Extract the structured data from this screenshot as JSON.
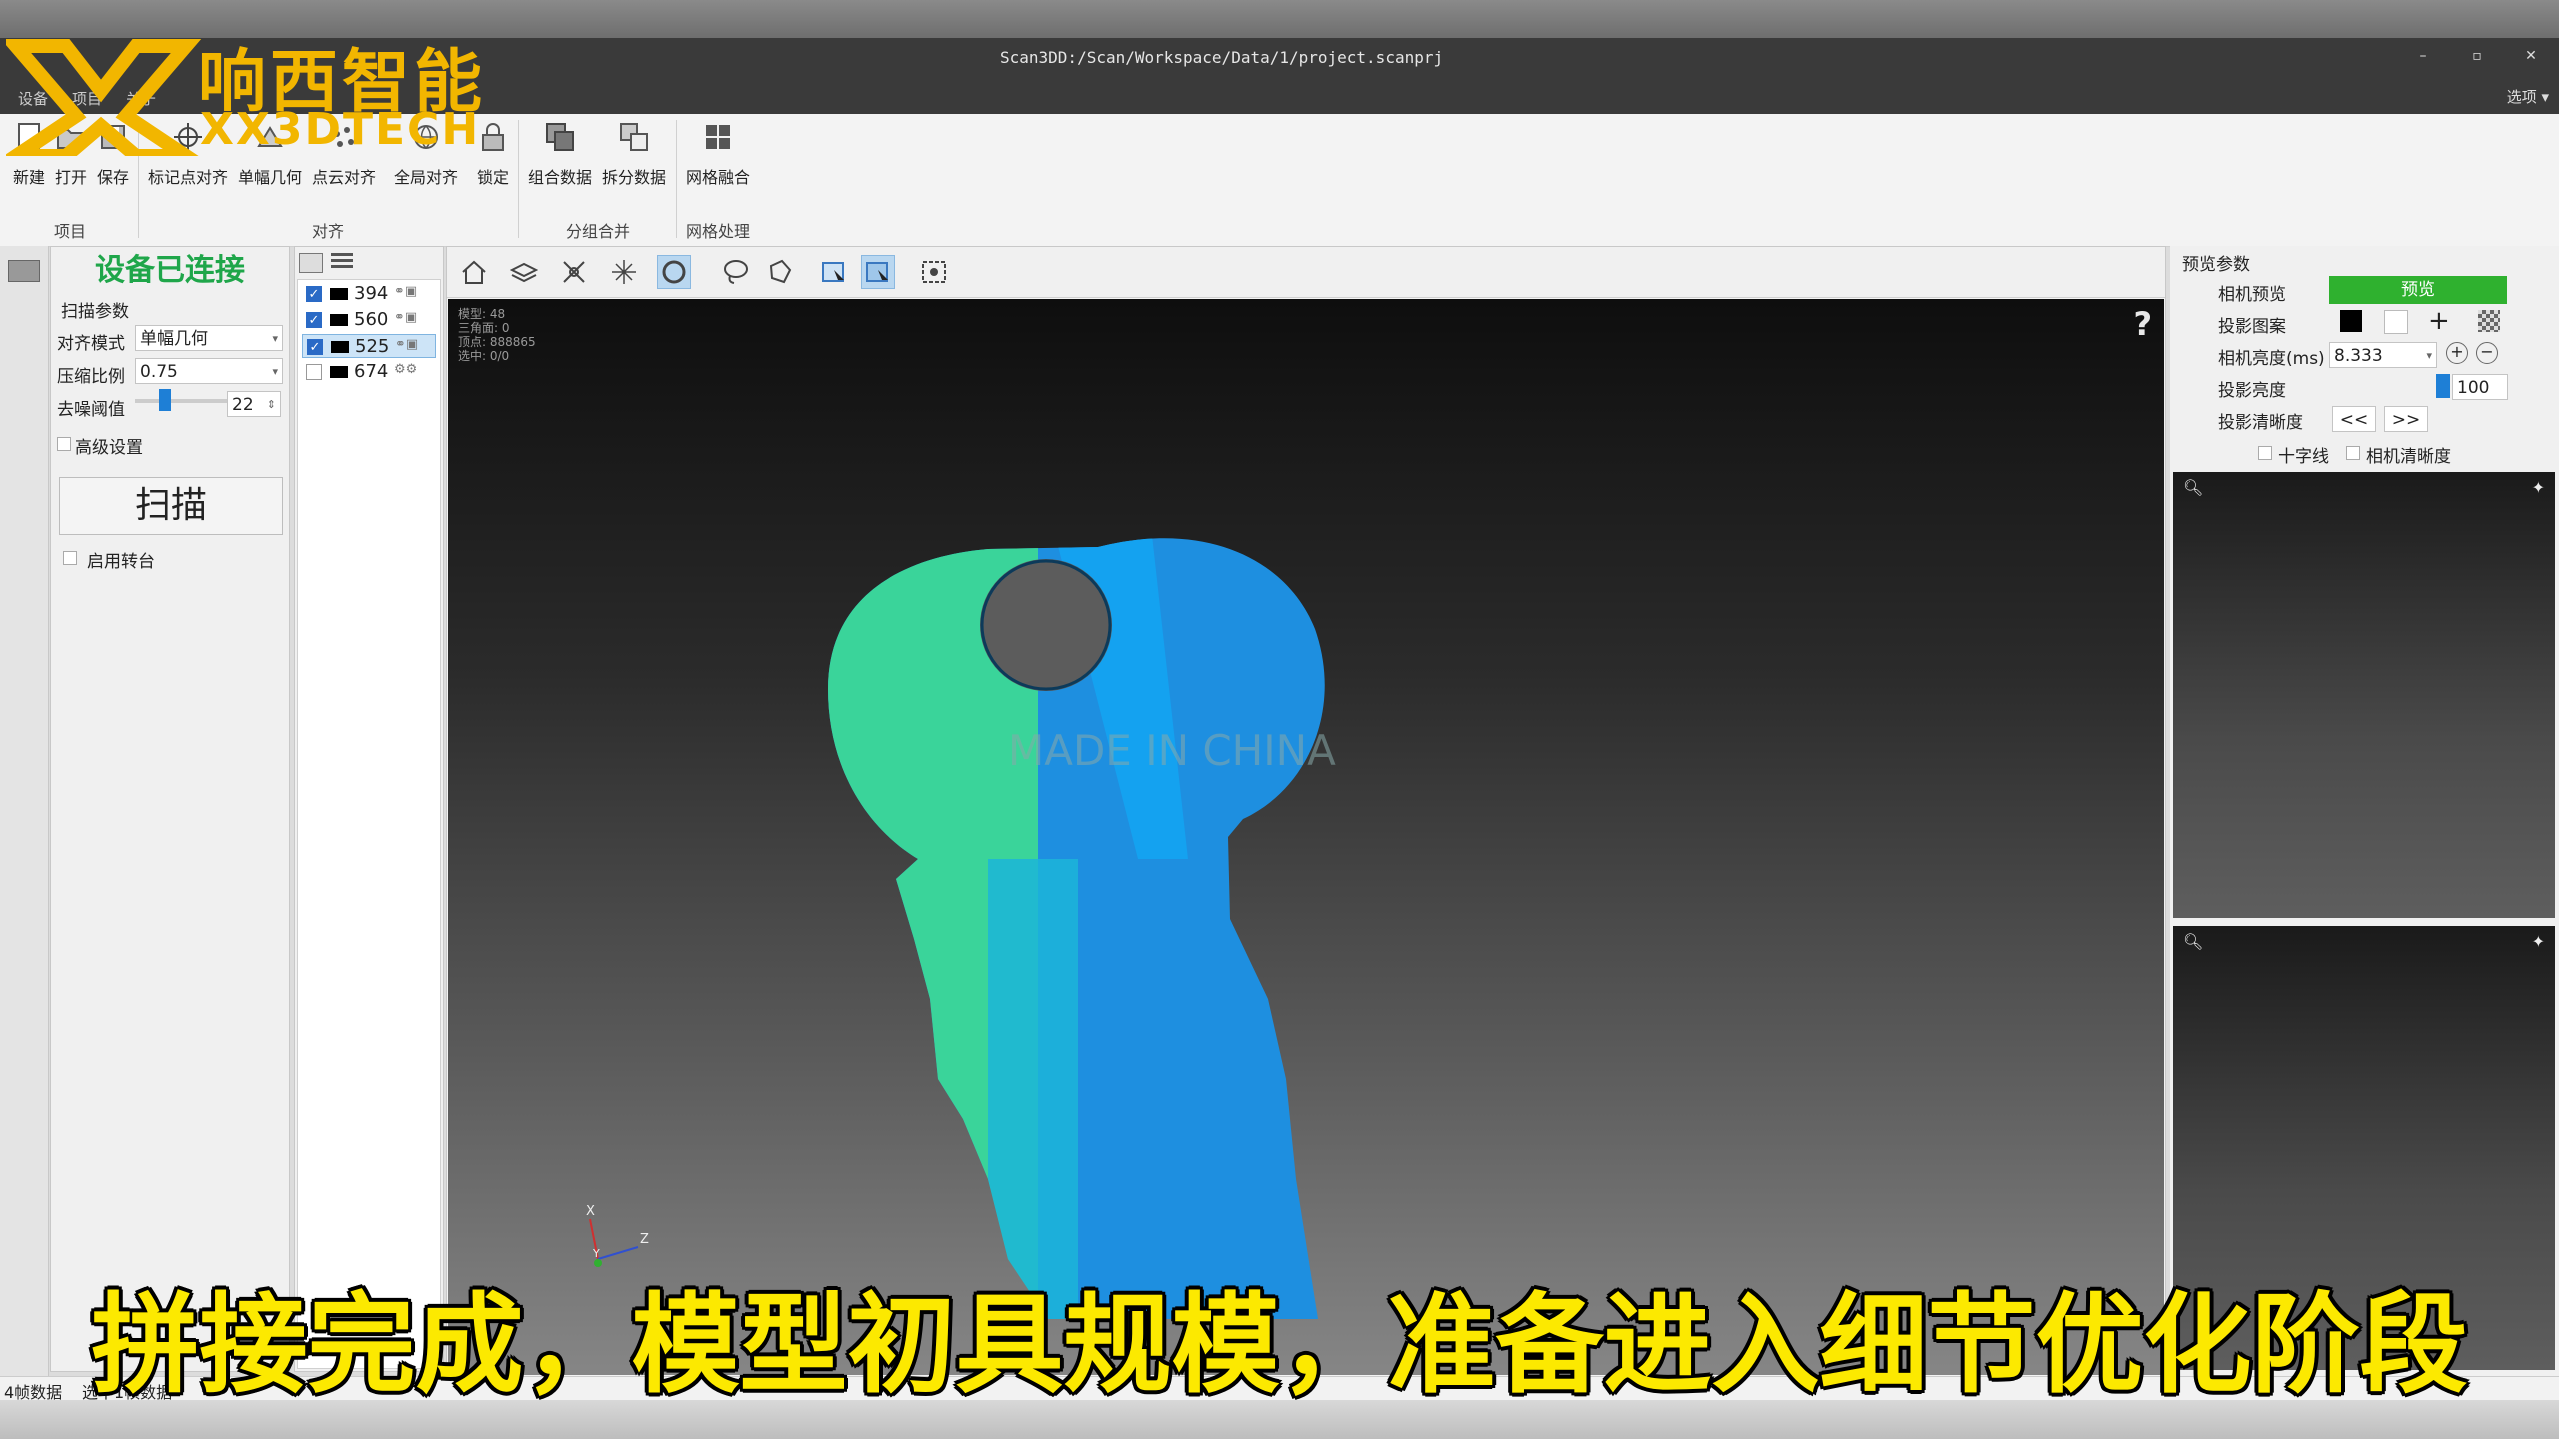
{
  "window": {
    "title": "Scan3DD:/Scan/Workspace/Data/1/project.scanprj",
    "options_label": "选项 ▾",
    "controls": [
      "–",
      "▫",
      "✕"
    ]
  },
  "menu": [
    "设备",
    "项目",
    "关于"
  ],
  "watermark": {
    "brand_cn": "响西智能",
    "brand_en": "XX3DTECH",
    "color": "#f2b600"
  },
  "ribbon": {
    "buttons": {
      "new": "新建",
      "open": "打开",
      "save": "保存",
      "marker_align": "标记点对齐",
      "single_geo": "单幅几何",
      "cloud_align": "点云对齐",
      "global_align": "全局对齐",
      "lock": "锁定",
      "combine": "组合数据",
      "split": "拆分数据",
      "mesh_fuse": "网格融合"
    },
    "groups": {
      "project": "项目",
      "align": "对齐",
      "group_merge": "分组合并",
      "mesh": "网格处理"
    }
  },
  "scan_panel": {
    "status": "设备已连接",
    "section_title": "扫描参数",
    "align_mode": {
      "label": "对齐模式",
      "value": "单幅几何"
    },
    "compression": {
      "label": "压缩比例",
      "value": "0.75"
    },
    "denoise": {
      "label": "去噪阈值",
      "value": "22"
    },
    "advanced": "高级设置",
    "scan_button": "扫描",
    "turntable": "启用转台",
    "status_color": "#1fa64a"
  },
  "frame_list": {
    "items": [
      {
        "label": "394",
        "checked": "✓"
      },
      {
        "label": "560",
        "checked": "✓"
      },
      {
        "label": "525",
        "checked": "✓"
      },
      {
        "label": "674",
        "checked": ""
      }
    ]
  },
  "viewport": {
    "info": [
      "模型: 48",
      "三角面: 0",
      "顶点: 888865",
      "选中: 0/0"
    ],
    "help": "?",
    "axes": {
      "x": "X",
      "y": "Y",
      "z": "Z"
    },
    "key_text": "MADE IN CHINA",
    "colors": {
      "teal": "#3ad6a0",
      "blue": "#1a8fe0"
    }
  },
  "preview_panel": {
    "title": "预览参数",
    "camera_preview": {
      "label": "相机预览",
      "button": "预览",
      "color": "#2fb12f"
    },
    "projection_pattern": {
      "label": "投影图案"
    },
    "camera_exposure": {
      "label": "相机亮度(ms)",
      "value": "8.333"
    },
    "projection_brightness": {
      "label": "投影亮度",
      "value": "100"
    },
    "projection_clarity": {
      "label": "投影清晰度",
      "prev": "<<",
      "next": ">>"
    },
    "crosshair": "十字线",
    "camera_clarity": "相机清晰度"
  },
  "status_bar": {
    "frames": "4帧数据",
    "selected": "选中1帧数据"
  },
  "subtitle": "拼接完成，模型初具规模，准备进入细节优化阶段"
}
